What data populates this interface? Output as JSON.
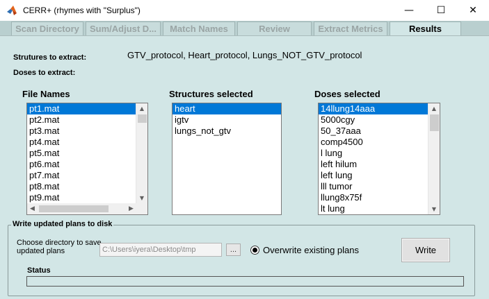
{
  "window": {
    "title": "CERR+ (rhymes with \"Surplus\")",
    "minimize_glyph": "—",
    "maximize_glyph": "☐",
    "close_glyph": "✕"
  },
  "tabs": [
    {
      "label": "Scan Directory",
      "active": false
    },
    {
      "label": "Sum/Adjust D...",
      "active": false
    },
    {
      "label": "Match Names",
      "active": false
    },
    {
      "label": "Review",
      "active": false
    },
    {
      "label": "Extract Metrics",
      "active": false
    },
    {
      "label": "Results",
      "active": true
    }
  ],
  "extract": {
    "structures_label": "Strutures to extract:",
    "structures_value": "GTV_protocol, Heart_protocol, Lungs_NOT_GTV_protocol",
    "doses_label": "Doses to extract:"
  },
  "lists": {
    "files": {
      "header": "File Names",
      "items": [
        "pt1.mat",
        "pt2.mat",
        "pt3.mat",
        "pt4.mat",
        "pt5.mat",
        "pt6.mat",
        "pt7.mat",
        "pt8.mat",
        "pt9.mat"
      ]
    },
    "structures": {
      "header": "Structures selected",
      "items": [
        "heart",
        "igtv",
        "lungs_not_gtv"
      ]
    },
    "doses": {
      "header": "Doses selected",
      "items": [
        "14llung14aaa",
        "5000cgy",
        "50_37aaa",
        "comp4500",
        "l lung",
        "left hilum",
        "left lung",
        "lll tumor",
        "llung8x75f",
        "lt lung"
      ]
    }
  },
  "write": {
    "group_title": "Write updated plans to disk",
    "choose_label": "Choose directory to save updated plans",
    "path_value": "C:\\Users\\iyera\\Desktop\\tmp",
    "browse_label": "...",
    "overwrite_label": "Overwrite existing plans",
    "write_button": "Write",
    "status_label": "Status"
  },
  "colors": {
    "panel_bg": "#d2e6e6",
    "selection": "#0078d7"
  },
  "icons": {
    "app": "matlab-logo-icon",
    "scroll_up": "▲",
    "scroll_down": "▼",
    "scroll_left": "◀",
    "scroll_right": "▶"
  }
}
